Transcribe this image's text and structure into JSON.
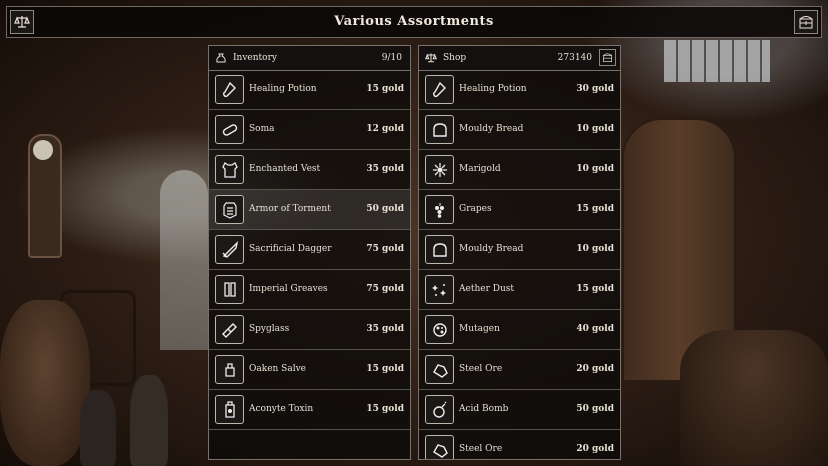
{
  "window_title": "Various Assortments",
  "icons": {
    "left_corner": "balance-scale-icon",
    "right_corner": "chest-icon"
  },
  "inventory": {
    "title": "Inventory",
    "count": "9/10",
    "header_icon": "pouch-icon",
    "items": [
      {
        "name": "Healing Potion",
        "price": "15 gold",
        "icon": "potion-icon"
      },
      {
        "name": "Soma",
        "price": "12 gold",
        "icon": "pill-icon"
      },
      {
        "name": "Enchanted Vest",
        "price": "35 gold",
        "icon": "vest-icon"
      },
      {
        "name": "Armor of Torment",
        "price": "50 gold",
        "icon": "armor-icon"
      },
      {
        "name": "Sacrificial Dagger",
        "price": "75 gold",
        "icon": "dagger-icon"
      },
      {
        "name": "Imperial Greaves",
        "price": "75 gold",
        "icon": "greaves-icon"
      },
      {
        "name": "Spyglass",
        "price": "35 gold",
        "icon": "spyglass-icon"
      },
      {
        "name": "Oaken Salve",
        "price": "15 gold",
        "icon": "salve-icon"
      },
      {
        "name": "Aconyte Toxin",
        "price": "15 gold",
        "icon": "toxin-icon"
      }
    ]
  },
  "shop": {
    "title": "Shop",
    "count": "273140",
    "header_icon": "balance-scale-icon",
    "items": [
      {
        "name": "Healing Potion",
        "price": "30 gold",
        "icon": "potion-icon"
      },
      {
        "name": "Mouldy Bread",
        "price": "10 gold",
        "icon": "bread-icon"
      },
      {
        "name": "Marigold",
        "price": "10 gold",
        "icon": "flower-icon"
      },
      {
        "name": "Grapes",
        "price": "15 gold",
        "icon": "grapes-icon"
      },
      {
        "name": "Mouldy Bread",
        "price": "10 gold",
        "icon": "bread-icon"
      },
      {
        "name": "Aether Dust",
        "price": "15 gold",
        "icon": "dust-icon"
      },
      {
        "name": "Mutagen",
        "price": "40 gold",
        "icon": "mutagen-icon"
      },
      {
        "name": "Steel Ore",
        "price": "20 gold",
        "icon": "ore-icon"
      },
      {
        "name": "Acid Bomb",
        "price": "50 gold",
        "icon": "bomb-icon"
      },
      {
        "name": "Steel Ore",
        "price": "20 gold",
        "icon": "ore-icon"
      }
    ]
  }
}
